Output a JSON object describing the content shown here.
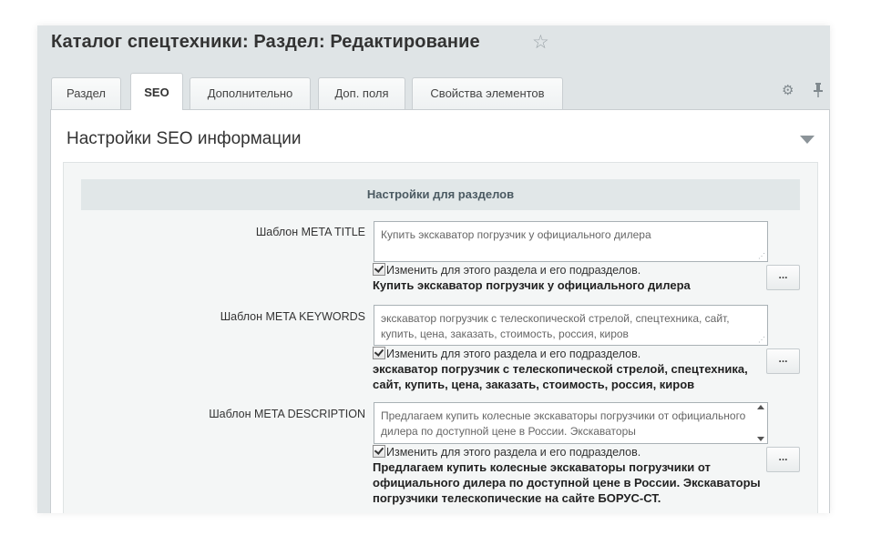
{
  "page": {
    "title": "Каталог спецтехники: Раздел: Редактирование"
  },
  "tabs": [
    {
      "label": "Раздел",
      "active": false
    },
    {
      "label": "SEO",
      "active": true
    },
    {
      "label": "Дополнительно",
      "active": false
    },
    {
      "label": "Доп. поля",
      "active": false
    },
    {
      "label": "Свойства элементов",
      "active": false
    }
  ],
  "icons": {
    "favorite": "star-outline-icon",
    "settings": "gear-icon",
    "pin": "pin-icon",
    "collapse": "triangle-down-icon"
  },
  "section": {
    "title": "Настройки SEO информации",
    "subheader": "Настройки для разделов",
    "fields": [
      {
        "label": "Шаблон META TITLE",
        "value": "Купить экскаватор погрузчик у официального дилера",
        "checkbox_label": "Изменить для этого раздела и его подразделов.",
        "checked": true,
        "preview": "Купить экскаватор погрузчик у официального дилера",
        "button_label": "..."
      },
      {
        "label": "Шаблон META KEYWORDS",
        "value": "экскаватор погрузчик с телескопической стрелой, спецтехника, сайт, купить, цена, заказать, стоимость, россия, киров",
        "checkbox_label": "Изменить для этого раздела и его подразделов.",
        "checked": true,
        "preview": "экскаватор погрузчик с телескопической стрелой, спецтехника, сайт, купить, цена, заказать, стоимость, россия, киров",
        "button_label": "..."
      },
      {
        "label": "Шаблон META DESCRIPTION",
        "value": "Предлагаем купить колесные экскаваторы погрузчики от официального дилера по доступной цене в России. Экскаваторы",
        "checkbox_label": "Изменить для этого раздела и его подразделов.",
        "checked": true,
        "preview": "Предлагаем купить колесные экскаваторы погрузчики от официального дилера по доступной цене в России. Экскаваторы погрузчики телескопические на сайте БОРУС-СТ.",
        "button_label": "..."
      }
    ]
  },
  "colors": {
    "frame_bg": "#dfe4e6",
    "panel_bg": "#ffffff",
    "subheader_bg": "#e1e7e8",
    "text": "#333333"
  }
}
